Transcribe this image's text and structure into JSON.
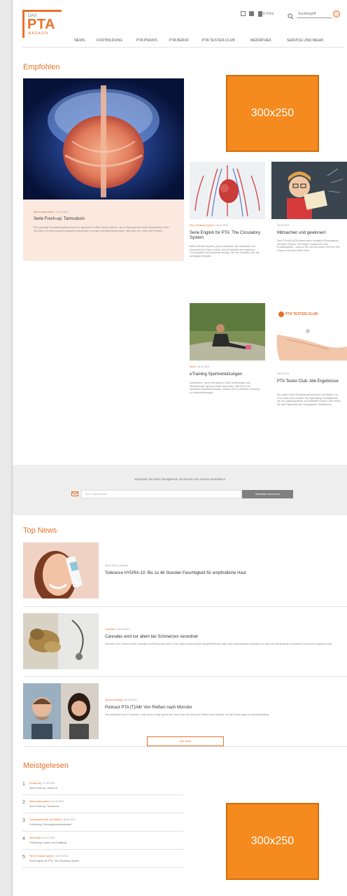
{
  "header": {
    "logo": {
      "das": "DAS",
      "pta": "PTA",
      "magazin": "MAGAZIN"
    },
    "print_link": "E-Print",
    "search_value": "Suchbegriff",
    "nav": [
      "NEWS",
      "FORTBILDUNG",
      "PTA PRAXIS",
      "PTA BERUF",
      "PTA TESTER-CLUB",
      "MEDIATHEK",
      "SERVICE UND MEHR"
    ]
  },
  "empfohlen": {
    "title": "Empfohlen",
    "feature": {
      "category": "Männergesundheit",
      "date": "01.03.2021",
      "title": "Serie Fresh-up: Tamsulosin",
      "text": "Eine gutartige Prostatavergrößerung ist ein typisches Problem älterer Männer, das zu Beschwerden beim Wasserlassen führt. Der Alpha-1A-Adrenozeptor-Antagonist Tamsulosin verringert die Miktionsstörungen, nicht aber die Größe der Prostata."
    },
    "ad_label": "300x250",
    "articles": [
      {
        "category": "Herz-Kreislauf-System",
        "date": "26.02.2021",
        "title": "Serie English for PTA: The Circulatory System",
        "text": "Beim Kreislauf-System, jenem Netzwerk, das Nährstoffe und Sauerstoff im Körper verteilt, sind Kenntnisse der englischen Fachbegriffe in der Apotheke wichtig. Hier ein Überblick über die wichtigsten Begriffe."
      },
      {
        "category": "",
        "date": "26.02.2021",
        "title": "Mitmachen und gewinnen!",
        "text": "Das PTA MAGAZIN bietet Ihnen monatlich Gewinnspiele mit tollen Preisen. Ob Bücher, Gutscheine oder Produktpakete – machen Sie mit und sichern Sie sich Ihre Chance auf einen tollen Preis."
      },
      {
        "category": "Sport",
        "date": "26.02.2021",
        "title": "eTraining Sportverletzungen",
        "text": "Unbestritten: Sport hält gesund. Doch Verletzungen und Überlastungen gehören leider auch dazu. Wie Sie in der Apotheke kompetent beraten, erfahren Sie in unserem eTraining zu Sportverletzungen."
      },
      {
        "category": "",
        "date": "26.02.2021",
        "title": "PTA Tester-Club: Alle Ergebnisse",
        "text": "Sie wollten neue Produkte kennenlernen und testen? Im PTA Tester-Club erhalten Sie regelmäßig Produktproben, die Sie ausgiebig testen und bewerten können. Hier finden Sie alle Ergebnisse der vergangenen Testaktionen."
      }
    ],
    "tester_logo": "PTA TESTER-CLUB"
  },
  "newsletter": {
    "text": "Verpassen Sie keine Neuigkeiten! Abonnieren Sie unseren Newsletter!",
    "placeholder": "Ihre E-Mail-Adresse",
    "button": "Newsletter abonnieren"
  },
  "top_news": {
    "title": "Top News",
    "items": [
      {
        "category": "Anzeige",
        "date": "08.02.2021",
        "title": "Tolérance HYDRA-10: Bis zu 48 Stunden Feuchtigkeit für empfindliche Haut",
        "text": ""
      },
      {
        "category": "Cannabis",
        "date": "26.02.2021",
        "title": "Cannabis wird vor allem bei Schmerzen verordnet",
        "text": "Seit März 2017 können Ärzte Cannabis auf Rezept verordnen. Eine erste Auswertung der Begleiterhebung zeigt, dass medizinisches Cannabis vor allem zur Behandlung chronischer Schmerzen eingesetzt wird."
      },
      {
        "category": "Apothekenalltag",
        "date": "26.02.2021",
        "title": "Podcast PTA (T)Alk! Von Reißen nach Münster",
        "text": "Vom Apotheker zum Podcaster: In der neuen Folge spricht das Team über den Weg von Reißen nach Münster und die Erfahrungen im Apothekenalltag."
      }
    ],
    "more_button": "Alle News"
  },
  "meistgelesen": {
    "title": "Meistgelesen",
    "ad_label": "300x250",
    "items": [
      {
        "num": "1",
        "category": "Ernährung",
        "date": "27.02.2021",
        "text": "Serie Fresh-up: Vitamin D"
      },
      {
        "num": "2",
        "category": "Männergesundheit",
        "date": "01.03.2021",
        "text": "Serie Fresh-up: Tamsulosin"
      },
      {
        "num": "3",
        "category": "Schwangerschaft und Stillzeit",
        "date": "26.02.2021",
        "text": "Fortbildung: Schwangerschaftsübelkeit"
      },
      {
        "num": "4",
        "category": "Atemwege",
        "date": "26.02.2021",
        "text": "Fortbildung: Husten und Erkältung"
      },
      {
        "num": "5",
        "category": "Herz-Kreislauf-System",
        "date": "26.02.2021",
        "text": "Serie English for PTA: The Circulatory System"
      }
    ]
  },
  "colors": {
    "accent": "#e8722a",
    "ad": "#f58a1f",
    "card_bg": "#fbe9e0"
  }
}
